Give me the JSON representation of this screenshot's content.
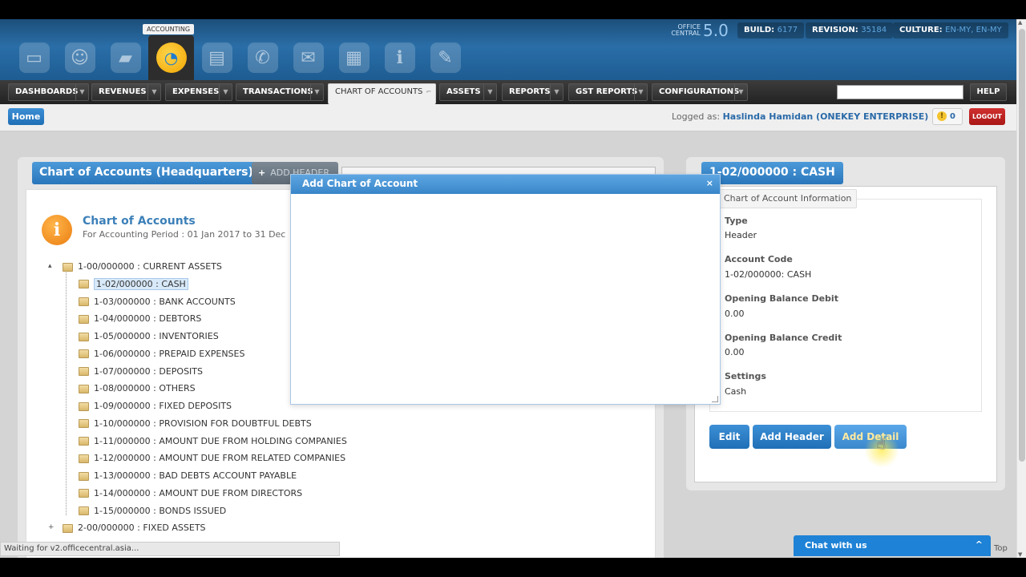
{
  "header": {
    "active_module_tag": "ACCOUNTING",
    "office_label_line1": "OFFICE",
    "office_label_line2": "CENTRAL",
    "version": "5.0",
    "build_label": "BUILD:",
    "build_value": "6177",
    "revision_label": "REVISION:",
    "revision_value": "35184",
    "culture_label": "CULTURE:",
    "culture_value": "EN-MY, EN-MY",
    "modules": [
      {
        "icon": "monitor-icon",
        "glyph": "▭"
      },
      {
        "icon": "user-icon",
        "glyph": "☺"
      },
      {
        "icon": "box-icon",
        "glyph": "▰"
      },
      {
        "icon": "pie-chart-icon",
        "glyph": "◔"
      },
      {
        "icon": "document-icon",
        "glyph": "▤"
      },
      {
        "icon": "phone-icon",
        "glyph": "✆"
      },
      {
        "icon": "chat-bubbles-icon",
        "glyph": "✉"
      },
      {
        "icon": "folders-icon",
        "glyph": "▦"
      },
      {
        "icon": "info-icon",
        "glyph": "ℹ"
      },
      {
        "icon": "edit-document-icon",
        "glyph": "✎"
      }
    ]
  },
  "nav": {
    "items": [
      "DASHBOARDS",
      "REVENUES",
      "EXPENSES",
      "TRANSACTIONS",
      "CHART OF ACCOUNTS",
      "ASSETS",
      "REPORTS",
      "GST REPORTS",
      "CONFIGURATIONS"
    ],
    "active": "CHART OF ACCOUNTS",
    "help": "HELP"
  },
  "subbar": {
    "home": "Home",
    "logged_as": "Logged as:",
    "user": "Haslinda Hamidan (ONEKEY ENTERPRISE)",
    "alert_count": "0",
    "logout": "LOGOUT"
  },
  "left": {
    "title": "Chart of Accounts (Headquarters)",
    "add_header_tab": "ADD HEADER",
    "coa_title": "Chart of Accounts",
    "coa_period": "For Accounting Period : 01 Jan 2017 to 31 Dec",
    "tree": [
      {
        "label": "1-00/000000 : CURRENT ASSETS",
        "level": 0,
        "selected": false
      },
      {
        "label": "1-02/000000 : CASH",
        "level": 1,
        "selected": true
      },
      {
        "label": "1-03/000000 : BANK ACCOUNTS",
        "level": 1,
        "selected": false
      },
      {
        "label": "1-04/000000 : DEBTORS",
        "level": 1,
        "selected": false
      },
      {
        "label": "1-05/000000 : INVENTORIES",
        "level": 1,
        "selected": false
      },
      {
        "label": "1-06/000000 : PREPAID EXPENSES",
        "level": 1,
        "selected": false
      },
      {
        "label": "1-07/000000 : DEPOSITS",
        "level": 1,
        "selected": false
      },
      {
        "label": "1-08/000000 : OTHERS",
        "level": 1,
        "selected": false
      },
      {
        "label": "1-09/000000 : FIXED DEPOSITS",
        "level": 1,
        "selected": false
      },
      {
        "label": "1-10/000000 : PROVISION FOR DOUBTFUL DEBTS",
        "level": 1,
        "selected": false
      },
      {
        "label": "1-11/000000 : AMOUNT DUE FROM HOLDING COMPANIES",
        "level": 1,
        "selected": false
      },
      {
        "label": "1-12/000000 : AMOUNT DUE FROM RELATED COMPANIES",
        "level": 1,
        "selected": false
      },
      {
        "label": "1-13/000000 : BAD DEBTS ACCOUNT PAYABLE",
        "level": 1,
        "selected": false
      },
      {
        "label": "1-14/000000 : AMOUNT DUE FROM DIRECTORS",
        "level": 1,
        "selected": false
      },
      {
        "label": "1-15/000000 : BONDS ISSUED",
        "level": 1,
        "selected": false
      },
      {
        "label": "2-00/000000 : FIXED ASSETS",
        "level": 0,
        "selected": false
      }
    ]
  },
  "right": {
    "title": "1-02/000000 : CASH",
    "legend": "Chart of Account Information",
    "fields": [
      {
        "label": "Type",
        "value": "Header"
      },
      {
        "label": "Account Code",
        "value": "1-02/000000: CASH"
      },
      {
        "label": "Opening Balance Debit",
        "value": "0.00"
      },
      {
        "label": "Opening Balance Credit",
        "value": "0.00"
      },
      {
        "label": "Settings",
        "value": "Cash"
      }
    ],
    "buttons": {
      "edit": "Edit",
      "add_header": "Add Header",
      "add_detail": "Add Detail"
    }
  },
  "modal": {
    "title": "Add Chart of Account",
    "close": "×"
  },
  "status": "Waiting for v2.officecentral.asia...",
  "chat": {
    "label": "Chat with us",
    "caret": "^"
  },
  "top_link": "Top"
}
